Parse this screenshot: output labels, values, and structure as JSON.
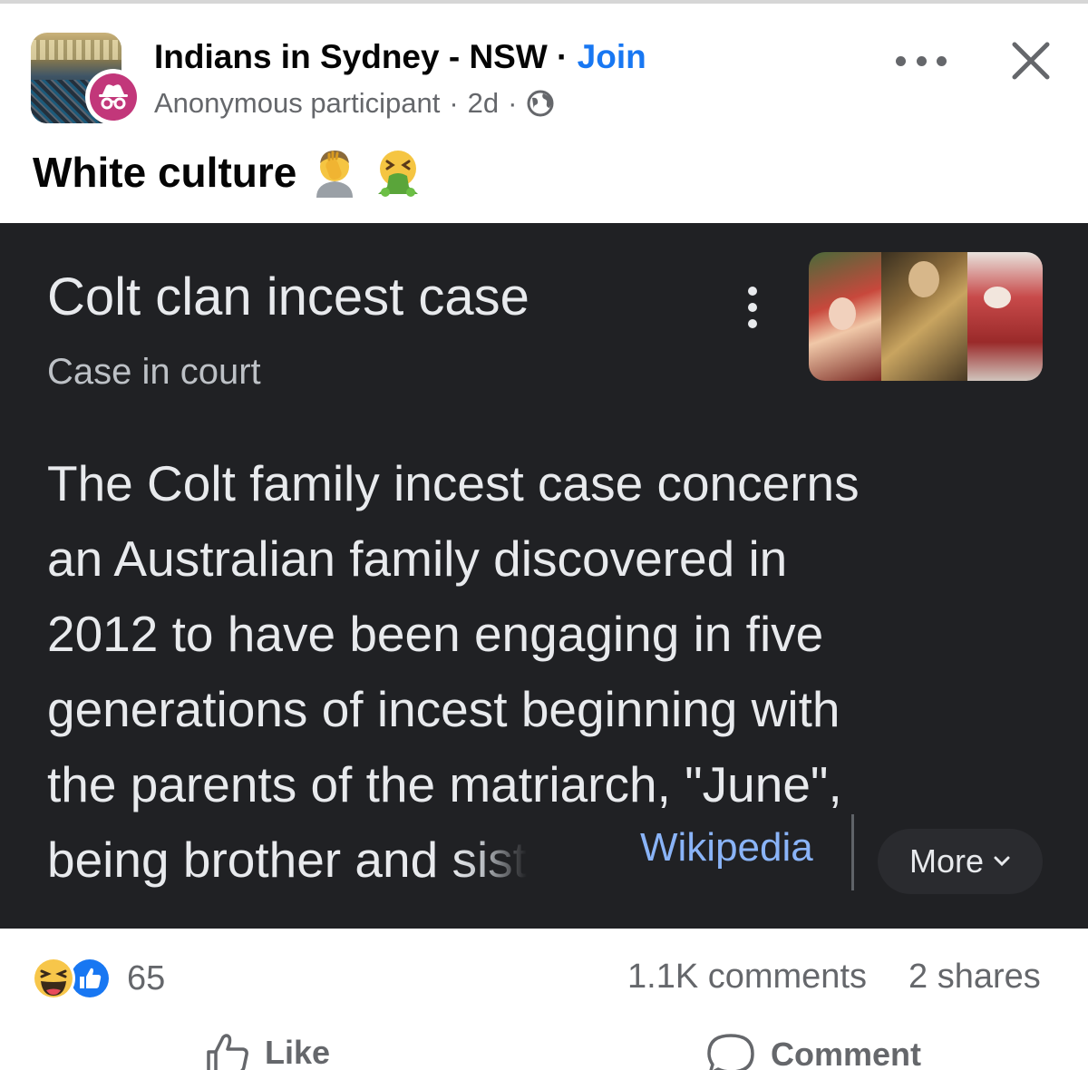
{
  "post_header": {
    "group_name": "Indians in Sydney - NSW",
    "separator": " · ",
    "join_label": "Join",
    "author": "Anonymous participant",
    "meta_separator": "·",
    "time_ago": "2d",
    "meta_separator_2": "·",
    "privacy_icon": "globe-icon",
    "more_icon": "more-horizontal-icon",
    "close_icon": "close-icon"
  },
  "post": {
    "text": "White culture",
    "emojis": [
      "facepalm-emoji",
      "vomit-emoji"
    ]
  },
  "shared_image": {
    "title": "Colt clan incest case",
    "subtitle": "Case in court",
    "body_lines": [
      "The Colt family incest case concerns",
      "an Australian family discovered in",
      "2012 to have been engaging in five",
      "generations of incest beginning with",
      "the parents of the matriarch, \"June\","
    ],
    "last_line_visible": "being brother and ",
    "last_line_faded": "sist",
    "source_link": "Wikipedia",
    "more_label": "More",
    "more_icon": "chevron-down-icon",
    "kebab_icon": "more-vertical-icon"
  },
  "engagement": {
    "reaction_icons": [
      "haha-reaction-icon",
      "like-reaction-icon"
    ],
    "reaction_count": "65",
    "comments": "1.1K comments",
    "shares": "2 shares"
  },
  "actions": {
    "like_label": "Like",
    "comment_label": "Comment"
  },
  "colors": {
    "link_blue": "#1877f2",
    "secondary_text": "#65676b",
    "dark_card": "#202124",
    "wiki_link": "#8ab4f8",
    "anon_badge": "#c2377a"
  }
}
